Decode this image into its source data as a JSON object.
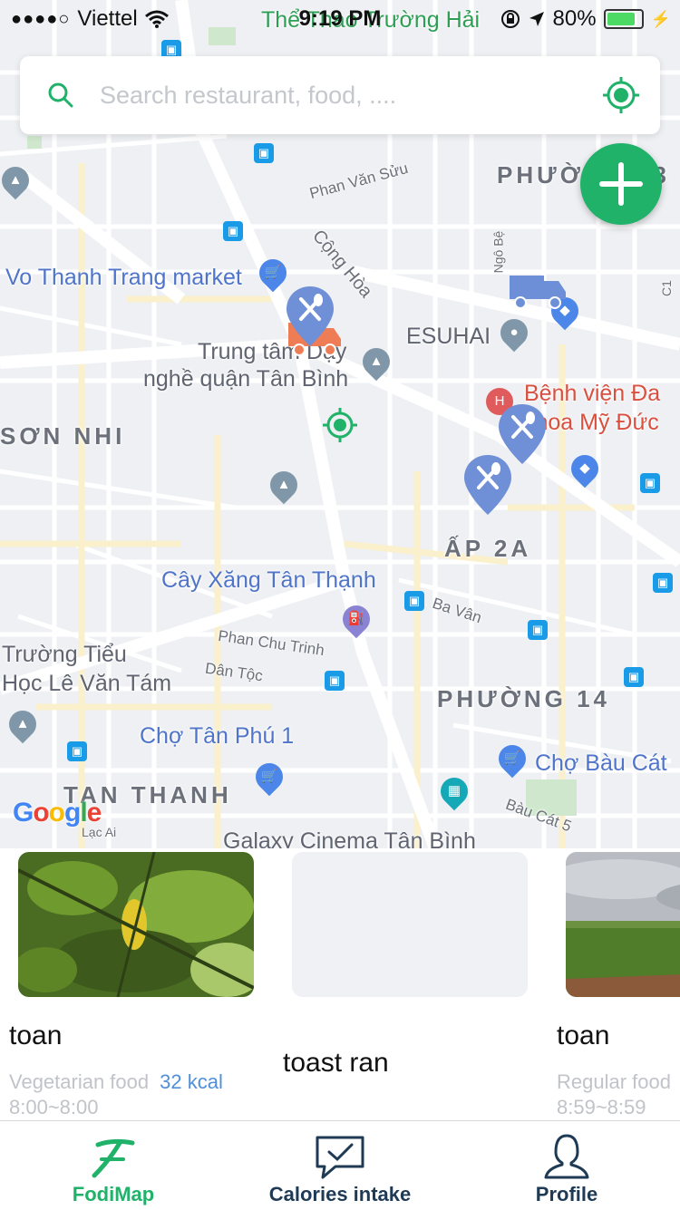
{
  "status_bar": {
    "carrier": "Viettel",
    "time": "9:19 PM",
    "battery": "80%"
  },
  "search": {
    "placeholder": "Search restaurant, food, ...."
  },
  "map": {
    "labels": {
      "the_thao": "Thể Thao Trường Hải",
      "vo_thanh_trang": "Vo Thanh Trang market",
      "trung_tam_1": "Trung tâm Dạy",
      "trung_tam_2": "nghề quận Tân Bình",
      "esuhai": "ESUHAI",
      "benh_vien_1": "Bệnh viện Đa",
      "benh_vien_2": "khoa Mỹ Đức",
      "son_nhi": "SƠN NHI",
      "ap_2a": "ẤP 2A",
      "cay_xang": "Cây Xăng Tân Thạnh",
      "truong_tieu_1": "Trường Tiểu",
      "truong_tieu_2": "Học Lê Văn Tám",
      "phuong_14": "PHƯỜNG 14",
      "cho_tan_phu": "Chợ Tân Phú 1",
      "cho_bau_cat": "Chợ Bàu Cát",
      "tan_thanh": "TAN THANH",
      "galaxy": "Galaxy Cinema Tân Bình",
      "phuong_13": "PHƯỜNG 13",
      "cong_hoa": "Cộng Hòa",
      "phan_van_suu": "Phan Văn Sửu",
      "ngo_be": "Ngô Bệ",
      "ba_van": "Ba Vân",
      "phan_chu_trinh": "Phan Chu Trinh",
      "dan_toc": "Dân Tộc",
      "bau_cat_5": "Bàu Cát 5",
      "lac_ai": "Lạc Ai",
      "c1": "C1",
      "hospital_letter": "H",
      "google": "Google"
    }
  },
  "cards": [
    {
      "name": "toan",
      "category": "Vegetarian food",
      "kcal": "32 kcal",
      "hours": "8:00~8:00"
    },
    {
      "name": "toast ran"
    },
    {
      "name": "toan",
      "category": "Regular food",
      "hours": "8:59~8:59"
    }
  ],
  "tabs": [
    {
      "label": "FodiMap",
      "icon": "fodimap-logo-icon"
    },
    {
      "label": "Calories intake",
      "icon": "chat-check-icon"
    },
    {
      "label": "Profile",
      "icon": "person-icon"
    }
  ],
  "colors": {
    "accent": "#21b26a",
    "pin": "#6f8fd6",
    "kcal": "#4f8fdb"
  }
}
